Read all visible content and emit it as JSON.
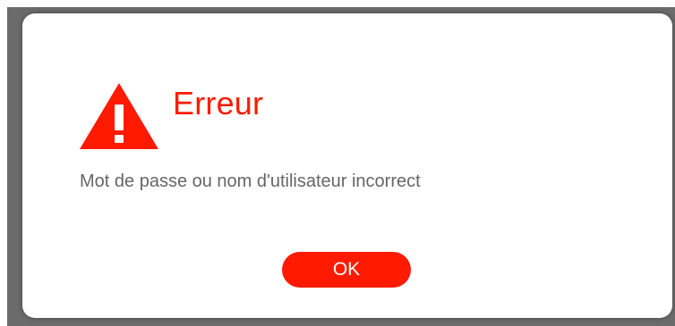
{
  "dialog": {
    "icon": "warning-triangle-icon",
    "title": "Erreur",
    "message": "Mot de passe ou nom d'utilisateur incorrect",
    "ok_label": "OK"
  },
  "colors": {
    "accent": "#ff1a00",
    "message_text": "#666666",
    "backdrop": "#6b6b6b",
    "dialog_background": "#ffffff"
  }
}
